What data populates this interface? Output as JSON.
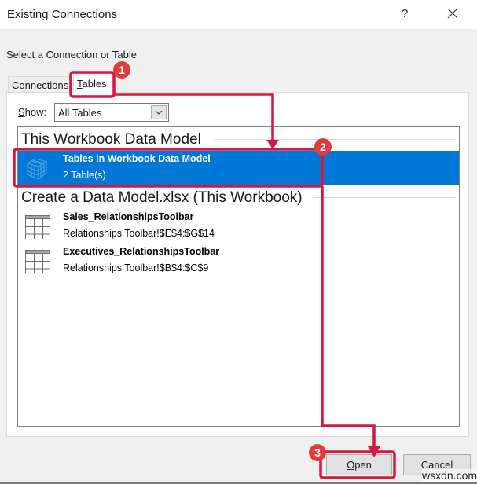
{
  "window": {
    "title": "Existing Connections",
    "help_label": "?",
    "close_icon": "close-icon"
  },
  "subtitle": "Select a Connection or Table",
  "tabs": [
    {
      "label_ul": "C",
      "label_rest": "onnections",
      "active": false
    },
    {
      "label_ul": "T",
      "label_rest": "ables",
      "active": true
    }
  ],
  "show": {
    "label_ul": "S",
    "label_rest": "how:",
    "value": "All Tables"
  },
  "list": {
    "groups": [
      {
        "header": "This Workbook Data Model",
        "items": [
          {
            "name": "Tables in Workbook Data Model",
            "sub": "2 Table(s)",
            "icon": "data-model-cube-icon",
            "selected": true
          }
        ]
      },
      {
        "header": "Create a Data Model.xlsx (This Workbook)",
        "items": [
          {
            "name": "Sales_RelationshipsToolbar",
            "sub": "Relationships Toolbar!$E$4:$G$14",
            "icon": "table-icon",
            "selected": false
          },
          {
            "name": "Executives_RelationshipsToolbar",
            "sub": "Relationships Toolbar!$B$4:$C$9",
            "icon": "table-icon",
            "selected": false
          }
        ]
      }
    ]
  },
  "buttons": {
    "open_ul": "O",
    "open_rest": "pen",
    "cancel": "Cancel"
  },
  "annotations": {
    "color": "#d6173f",
    "badge_color": "#e03c3c",
    "steps": [
      "1",
      "2",
      "3"
    ]
  },
  "watermark": "wsxdn.com"
}
